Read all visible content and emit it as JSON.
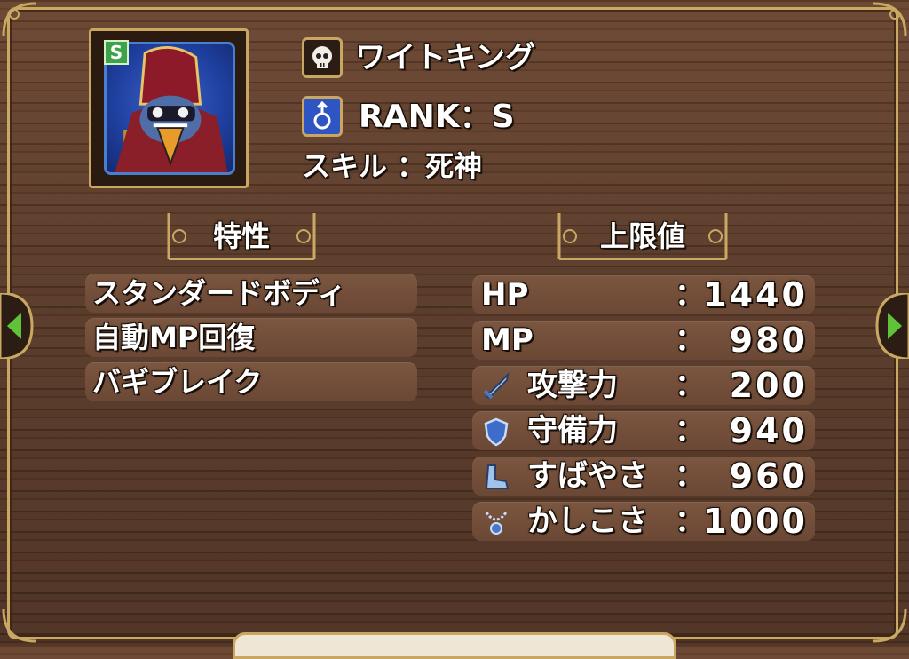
{
  "monster": {
    "name": "ワイトキング",
    "rank_text": "RANK：S",
    "rank_badge": "S",
    "skill_text": "スキル ：死神",
    "type_icon": "skull-icon",
    "gender_icon": "male-symbol-icon"
  },
  "headers": {
    "traits": "特性",
    "stats": "上限値"
  },
  "traits": [
    "スタンダードボディ",
    "自動MP回復",
    "バギブレイク"
  ],
  "stats": [
    {
      "label": "HP",
      "value": "1440",
      "icon": ""
    },
    {
      "label": "MP",
      "value": "980",
      "icon": ""
    },
    {
      "label": "攻撃力",
      "value": "200",
      "icon": "sword-icon"
    },
    {
      "label": "守備力",
      "value": "940",
      "icon": "shield-icon"
    },
    {
      "label": "すばやさ",
      "value": "960",
      "icon": "boot-icon"
    },
    {
      "label": "かしこさ",
      "value": "1000",
      "icon": "necklace-icon"
    }
  ],
  "stat_colon": "：",
  "colors": {
    "frame_gold": "#c9a864",
    "wood": "#5a3a28",
    "pill": "#7b5640",
    "badge_green": "#3ca34a",
    "nav_green": "#5fc23a"
  }
}
